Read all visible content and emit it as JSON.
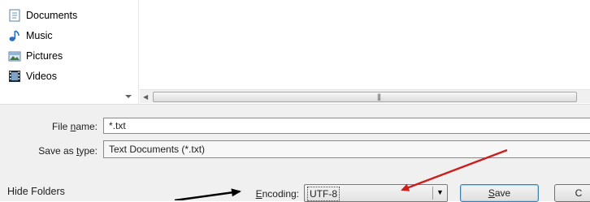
{
  "nav": {
    "items": [
      {
        "label": "Documents",
        "icon": "documents-icon"
      },
      {
        "label": "Music",
        "icon": "music-icon"
      },
      {
        "label": "Pictures",
        "icon": "pictures-icon"
      },
      {
        "label": "Videos",
        "icon": "videos-icon"
      }
    ]
  },
  "form": {
    "filename_label_pre": "File ",
    "filename_label_u": "n",
    "filename_label_post": "ame:",
    "filename_value": "*.txt",
    "savetype_label_pre": "Save as ",
    "savetype_label_u": "t",
    "savetype_label_post": "ype:",
    "savetype_value": "Text Documents (*.txt)",
    "encoding_label_u": "E",
    "encoding_label_post": "ncoding:",
    "encoding_value": "UTF-8"
  },
  "footer": {
    "hide_folders": "Hide Folders",
    "save_u": "S",
    "save_post": "ave",
    "cancel_visible": "C"
  },
  "annotation_colors": {
    "red_arrow": "#cc1f1f",
    "black_arrow": "#000000"
  }
}
